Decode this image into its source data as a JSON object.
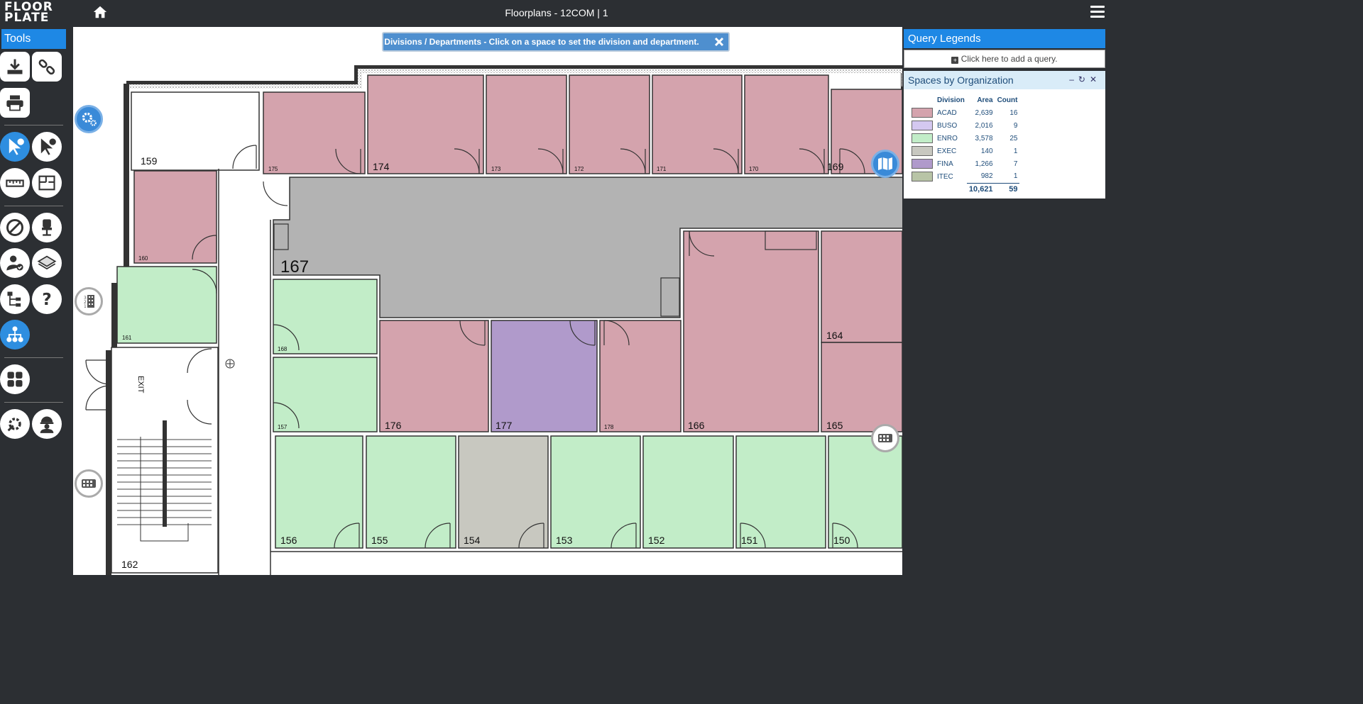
{
  "app": {
    "logo_line1": "FLOOR",
    "logo_line2": "PLATE",
    "title": "Floorplans - 12COM | 1"
  },
  "sidebar": {
    "header": "Tools"
  },
  "banner": {
    "text": "Divisions / Departments - Click on a space to set the division and department."
  },
  "query_legends": {
    "header": "Query Legends",
    "add_query": "Click here to add a query."
  },
  "org_legend": {
    "title": "Spaces by Organization",
    "columns": [
      "Division",
      "Area",
      "Count"
    ],
    "rows": [
      {
        "division": "ACAD",
        "area": "2,639",
        "count": "16",
        "color": "#d4a3ad"
      },
      {
        "division": "BUSO",
        "area": "2,016",
        "count": "9",
        "color": "#d4c8f0"
      },
      {
        "division": "ENRO",
        "area": "3,578",
        "count": "25",
        "color": "#c2edc8"
      },
      {
        "division": "EXEC",
        "area": "140",
        "count": "1",
        "color": "#c8c8c0"
      },
      {
        "division": "FINA",
        "area": "1,266",
        "count": "7",
        "color": "#b09acb"
      },
      {
        "division": "ITEC",
        "area": "982",
        "count": "1",
        "color": "#b8c4a6"
      }
    ],
    "total_area": "10,621",
    "total_count": "59"
  },
  "rooms": {
    "r159": "159",
    "r175": "175",
    "r174": "174",
    "r173": "173",
    "r172": "172",
    "r171": "171",
    "r170": "170",
    "r169": "169",
    "r160": "160",
    "r167": "167",
    "r161": "161",
    "r168": "168",
    "r157": "157",
    "r176": "176",
    "r177": "177",
    "r178": "178",
    "r166": "166",
    "r164": "164",
    "r165": "165",
    "r156": "156",
    "r155": "155",
    "r154": "154",
    "r153": "153",
    "r152": "152",
    "r151": "151",
    "r150": "150",
    "r162": "162",
    "exit": "EXIT"
  },
  "colors": {
    "acad": "#d4a3ad",
    "enro": "#c2edc8",
    "exec": "#c8c8c0",
    "fina": "#b09acb",
    "corridor": "#b3b3b3",
    "accent": "#1e88e5"
  }
}
